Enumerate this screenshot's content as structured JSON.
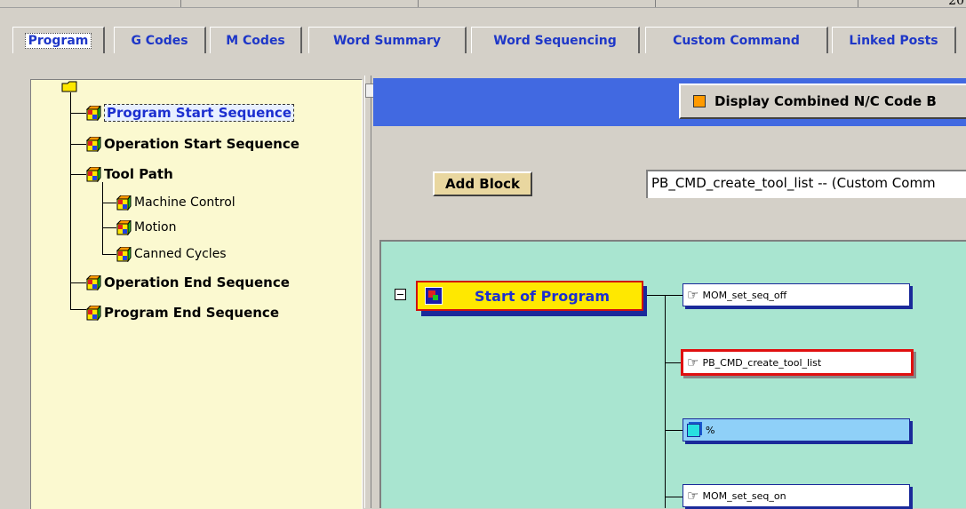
{
  "corner_text": "20",
  "tabs": [
    {
      "label": "Program",
      "active": true
    },
    {
      "label": "G Codes"
    },
    {
      "label": "M Codes"
    },
    {
      "label": "Word Summary"
    },
    {
      "label": "Word Sequencing"
    },
    {
      "label": "Custom Command"
    },
    {
      "label": "Linked Posts"
    }
  ],
  "tree": {
    "items": [
      {
        "label": "Program Start Sequence",
        "selected": true
      },
      {
        "label": "Operation Start Sequence"
      },
      {
        "label": "Tool Path"
      },
      {
        "label": "Machine Control"
      },
      {
        "label": "Motion"
      },
      {
        "label": "Canned Cycles"
      },
      {
        "label": "Operation End Sequence"
      },
      {
        "label": "Program End Sequence"
      }
    ]
  },
  "display_combined": {
    "label": "Display Combined N/C Code B",
    "checked": true,
    "check_color": "#ff9a00"
  },
  "add_block_label": "Add Block",
  "command_select_value": "PB_CMD_create_tool_list -- (Custom Comm",
  "sequence": {
    "root_label": "Start of Program",
    "blocks": [
      {
        "label": "MOM_set_seq_off",
        "icon": "hand-pointer-icon"
      },
      {
        "label": "PB_CMD_create_tool_list",
        "icon": "hand-pointer-icon",
        "highlighted": true
      },
      {
        "label": "%",
        "icon": "cube-icon"
      },
      {
        "label": "MOM_set_seq_on",
        "icon": "hand-pointer-icon"
      }
    ]
  },
  "colors": {
    "tab_text": "#1e37c8",
    "tree_bg": "#fbf9d0",
    "header_bar": "#4169e1",
    "canvas_bg": "#a9e5d0",
    "highlight_border": "#e01010",
    "start_block_bg": "#ffe800"
  }
}
